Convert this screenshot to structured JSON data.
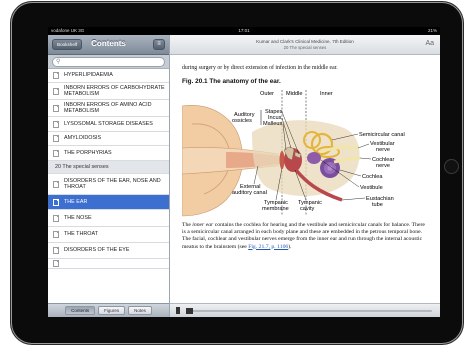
{
  "status_bar": {
    "carrier": "vodafone UK 3G",
    "time": "17:01",
    "battery": "21%"
  },
  "sidebar": {
    "bookshelf_label": "Bookshelf",
    "title": "Contents",
    "search_placeholder": "",
    "items": [
      {
        "label": "HYPERLIPIDAEMIA",
        "type": "doc"
      },
      {
        "label": "INBORN ERRORS OF CARBOHYDRATE METABOLISM",
        "type": "doc"
      },
      {
        "label": "INBORN ERRORS OF AMINO ACID METABOLISM",
        "type": "doc"
      },
      {
        "label": "LYSOSOMAL STORAGE DISEASES",
        "type": "doc"
      },
      {
        "label": "AMYLOIDOSIS",
        "type": "doc"
      },
      {
        "label": "THE PORPHYRIAS",
        "type": "doc"
      },
      {
        "label": "20 The special senses",
        "type": "section"
      },
      {
        "label": "DISORDERS OF THE EAR, NOSE AND THROAT",
        "type": "doc"
      },
      {
        "label": "THE EAR",
        "type": "doc",
        "active": true
      },
      {
        "label": "THE NOSE",
        "type": "doc"
      },
      {
        "label": "THE THROAT",
        "type": "doc"
      },
      {
        "label": "DISORDERS OF THE EYE",
        "type": "doc"
      },
      {
        "label": "",
        "type": "doc"
      }
    ],
    "tabs": [
      {
        "label": "Contents",
        "selected": true
      },
      {
        "label": "Figures",
        "selected": false
      },
      {
        "label": "Notes",
        "selected": false
      }
    ]
  },
  "content": {
    "book_title": "Kumar and Clark's Clinical Medicine, 7th Edition",
    "chapter_title": "20 The special senses",
    "font_button": "Aa",
    "lead_text": "during surgery or by direct extension of infection in the middle ear.",
    "figure_title": "Fig. 20.1 The anatomy of the ear.",
    "figure_labels": {
      "outer": "Outer",
      "middle": "Middle",
      "inner": "Inner",
      "auditory": "Auditory",
      "ossicles": "ossicles",
      "stapes": "Stapes",
      "incus": "Incus",
      "malleus": "Malleus",
      "semicircular": "Semicircular canal",
      "vestibular_1": "Vestibular",
      "vestibular_2": "nerve",
      "cochlear_1": "Cochlear",
      "cochlear_2": "nerve",
      "cochlea": "Cochlea",
      "vestibule": "Vestibule",
      "eustachian_1": "Eustachian",
      "eustachian_2": "tube",
      "external_1": "External",
      "external_2": "auditory canal",
      "tympanic_m1": "Tympanic",
      "tympanic_m2": "membrane",
      "tympanic_c1": "Tympanic",
      "tympanic_c2": "cavity"
    },
    "body_part_1": "The ",
    "body_italic": "inner ear",
    "body_part_2": " contains the cochlea for hearing and the vestibule and semicircular canals for balance. There is a semicircular canal arranged in each body plane and these are embedded in the petrous temporal bone. The facial, cochlear and vestibular nerves emerge from the inner ear and run through the internal acoustic meatus to the brainstem (see ",
    "body_link": "Fig. 21.7, p. 1106",
    "body_part_3": ").",
    "reading_progress": 0.0
  },
  "colors": {
    "accent": "#3d6fd0",
    "link": "#2456b3"
  }
}
